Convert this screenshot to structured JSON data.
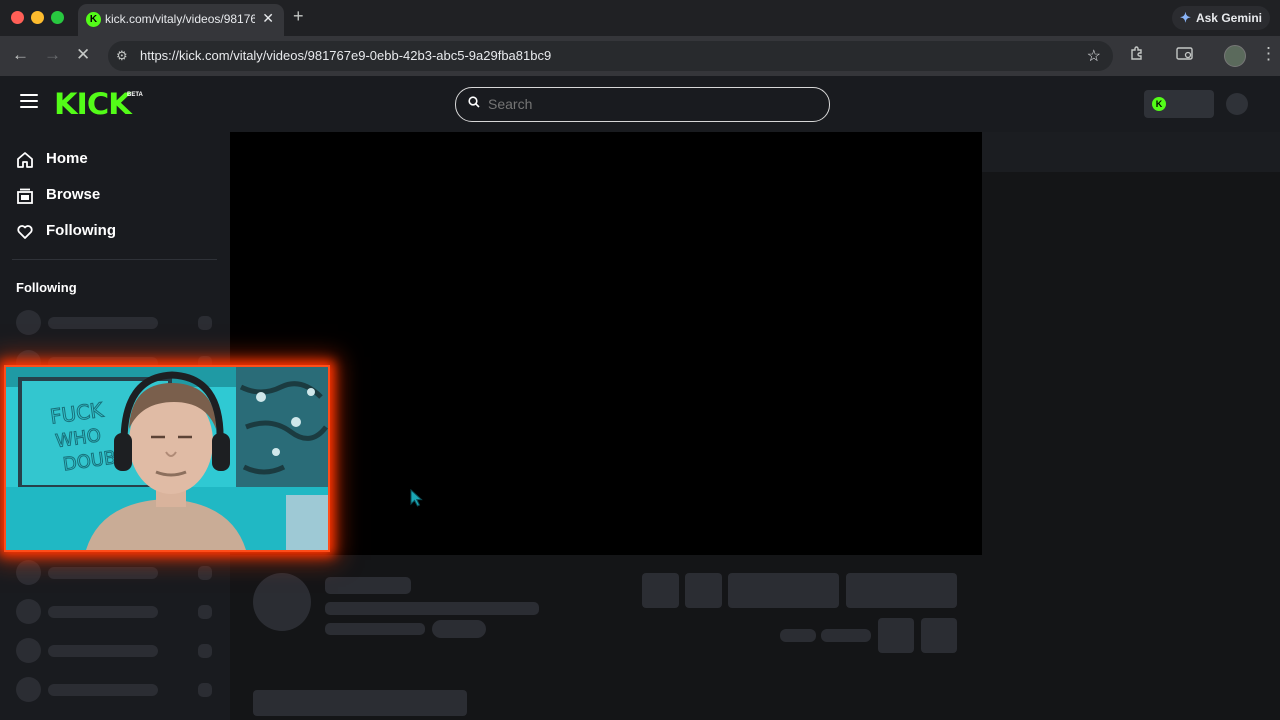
{
  "browser": {
    "tab_title": "kick.com/vitaly/videos/98176",
    "url": "https://kick.com/vitaly/videos/981767e9-0ebb-42b3-abc5-9a29fba81bc9",
    "gemini_label": "Ask Gemini"
  },
  "header": {
    "logo": "KICK",
    "beta": "BETA",
    "search_placeholder": "Search"
  },
  "sidebar": {
    "nav": [
      {
        "label": "Home",
        "icon": "home-icon"
      },
      {
        "label": "Browse",
        "icon": "browse-icon"
      },
      {
        "label": "Following",
        "icon": "heart-icon"
      }
    ],
    "section_title": "Following"
  },
  "webcam": {
    "wall_text": "FUCK WHO DOUBT",
    "frame_color": "#ff4d1a"
  },
  "colors": {
    "brand": "#53fc18",
    "background": "#141517",
    "sidebar": "#191b1f",
    "skeleton": "#2b2d33"
  }
}
